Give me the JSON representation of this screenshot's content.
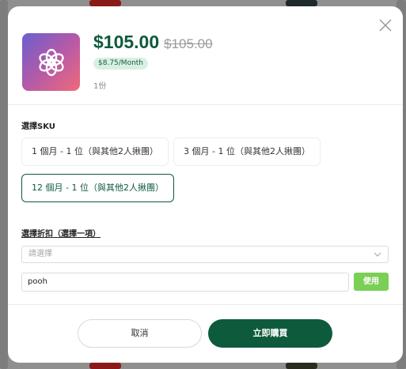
{
  "product": {
    "icon": "openai-logo-icon",
    "price_current": "$105.00",
    "price_original": "$105.00",
    "monthly_badge": "$8.75/Month",
    "quantity": "1份"
  },
  "sku": {
    "label": "選擇SKU",
    "options": [
      {
        "label": "1 個月 - 1 位（與其他2人揪團）",
        "selected": false
      },
      {
        "label": "3 個月 - 1 位（與其他2人揪團）",
        "selected": false
      },
      {
        "label": "12 個月 - 1 位（與其他2人揪團）",
        "selected": true
      }
    ]
  },
  "discount": {
    "label": "選擇折扣（選擇一項）",
    "select_placeholder": "請選擇",
    "coupon_value": "pooh",
    "apply_label": "使用"
  },
  "footer": {
    "cancel_label": "取消",
    "buy_label": "立即購買"
  },
  "colors": {
    "brand_green": "#0e5a3c",
    "apply_green": "#7bcf56"
  }
}
